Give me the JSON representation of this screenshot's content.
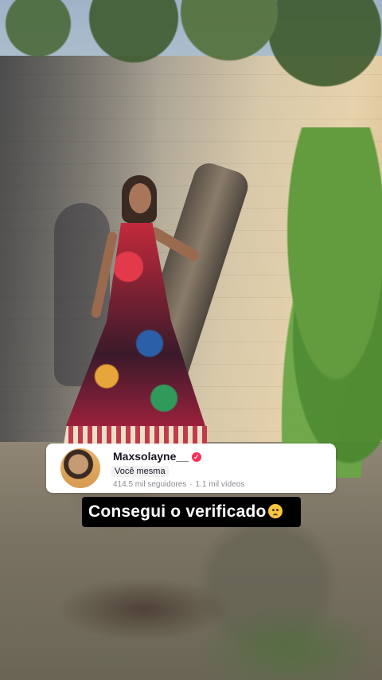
{
  "profile_card": {
    "username": "Maxsolayne__",
    "verified_icon": "verified-badge-icon",
    "subtitle": "Você mesma",
    "followers": "414.5 mil seguidores",
    "separator": "·",
    "videos": "1.1 mil vídeos"
  },
  "caption": {
    "text": "Consegui o verificado",
    "emoji_icon": "pleading-face-emoji-icon"
  },
  "colors": {
    "verified": "#fe2c55",
    "caption_bg": "#000000",
    "card_bg": "#ffffff"
  }
}
